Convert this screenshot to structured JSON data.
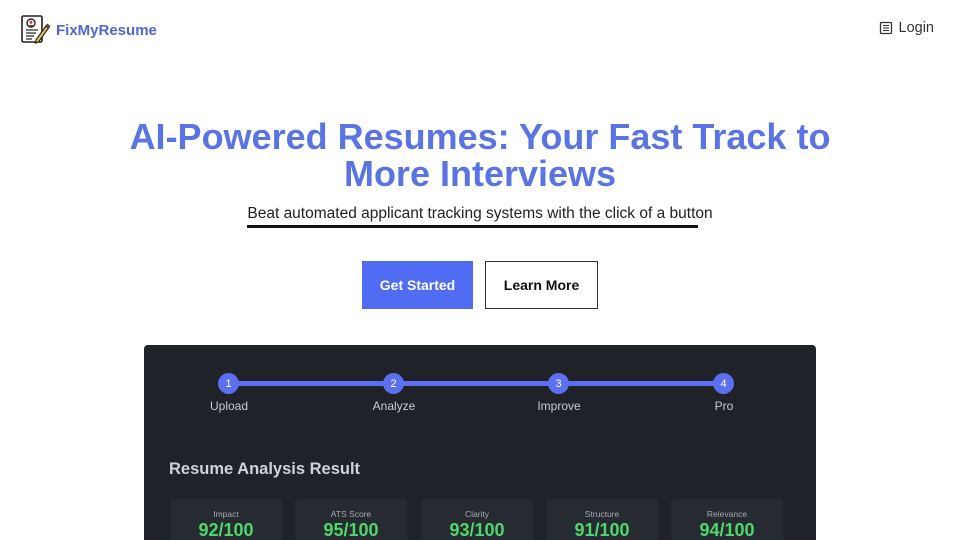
{
  "header": {
    "brand_name": "FixMyResume",
    "logo_icon": "resume-edit-icon",
    "login_label": "Login",
    "login_icon": "document-icon"
  },
  "hero": {
    "title_line1": "AI-Powered Resumes: Your Fast Track to",
    "title_line2": "More Interviews",
    "subtitle": "Beat automated applicant tracking systems with the click of a button",
    "primary_button": "Get Started",
    "secondary_button": "Learn More"
  },
  "steps": [
    {
      "number": "1",
      "label": "Upload"
    },
    {
      "number": "2",
      "label": "Analyze"
    },
    {
      "number": "3",
      "label": "Improve"
    },
    {
      "number": "4",
      "label": "Pro"
    }
  ],
  "analysis": {
    "title": "Resume Analysis Result",
    "scores": [
      {
        "label": "Impact",
        "value": "92/100"
      },
      {
        "label": "ATS Score",
        "value": "95/100"
      },
      {
        "label": "Clarity",
        "value": "93/100"
      },
      {
        "label": "Structure",
        "value": "91/100"
      },
      {
        "label": "Relevance",
        "value": "94/100"
      }
    ]
  },
  "colors": {
    "brand": "#5067d8",
    "title": "#5a74e4",
    "primary": "#4f6cf2",
    "panel_bg": "#1f2329",
    "score_green": "#4fd86a"
  }
}
